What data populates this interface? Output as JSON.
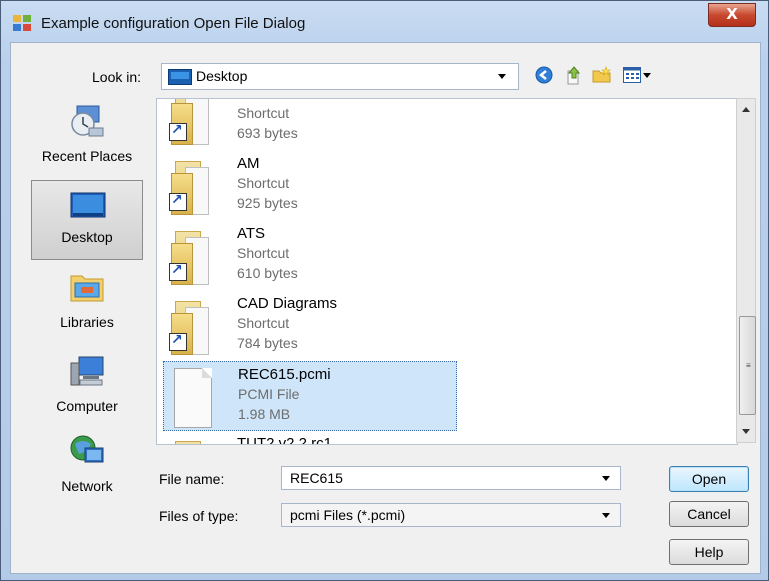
{
  "window": {
    "title": "Example configuration Open File Dialog",
    "close_label": "X"
  },
  "lookin": {
    "label": "Look in:",
    "value": "Desktop"
  },
  "places": [
    {
      "label": "Recent Places",
      "icon": "recent-places-icon"
    },
    {
      "label": "Desktop",
      "icon": "desktop-icon",
      "selected": true
    },
    {
      "label": "Libraries",
      "icon": "libraries-icon"
    },
    {
      "label": "Computer",
      "icon": "computer-icon"
    },
    {
      "label": "Network",
      "icon": "network-icon"
    }
  ],
  "files": [
    {
      "name": "",
      "type": "Shortcut",
      "size": "693 bytes",
      "kind": "shortcut-folder"
    },
    {
      "name": "AM",
      "type": "Shortcut",
      "size": "925 bytes",
      "kind": "shortcut-folder"
    },
    {
      "name": "ATS",
      "type": "Shortcut",
      "size": "610 bytes",
      "kind": "shortcut-folder"
    },
    {
      "name": "CAD  Diagrams",
      "type": "Shortcut",
      "size": "784 bytes",
      "kind": "shortcut-folder"
    },
    {
      "name": "REC615.pcmi",
      "type": "PCMI File",
      "size": "1.98 MB",
      "kind": "file",
      "selected": true
    },
    {
      "name": "TUT2 v2.2 rc1",
      "type": "",
      "size": "",
      "kind": "shortcut-folder"
    }
  ],
  "form": {
    "file_name_label": "File name:",
    "file_name_value": "REC615",
    "file_type_label": "Files of type:",
    "file_type_value": "pcmi Files (*.pcmi)"
  },
  "buttons": {
    "open": "Open",
    "cancel": "Cancel",
    "help": "Help"
  }
}
